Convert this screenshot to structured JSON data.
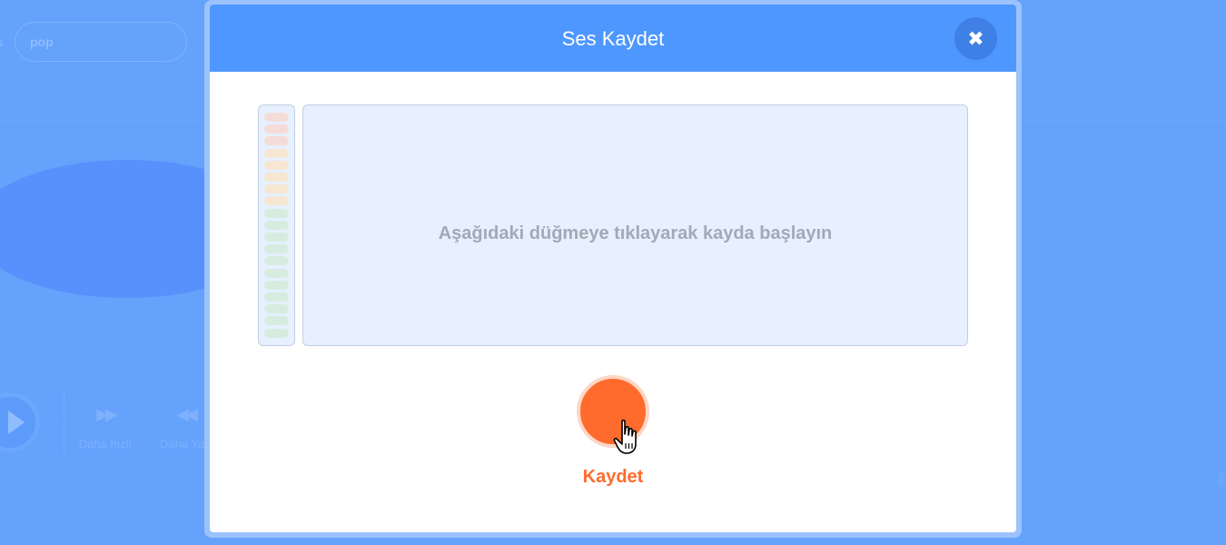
{
  "background": {
    "search_prefix": "s",
    "search_value": "pop",
    "controls": [
      {
        "icon": "fast-forward-icon",
        "glyph": "▶▶",
        "label": "Daha hızlı"
      },
      {
        "icon": "rewind-icon",
        "glyph": "◀◀",
        "label": "Daha Yav"
      }
    ]
  },
  "modal": {
    "title": "Ses Kaydet",
    "close_glyph": "✖",
    "instruction": "Aşağıdaki düğmeye tıklayarak kayda başlayın",
    "record_label": "Kaydet",
    "meter_colors": {
      "red": "#f6dcd9",
      "orange": "#f6e6d2",
      "green": "#d7ecdf"
    }
  },
  "colors": {
    "header": "#4d97ff",
    "record": "#ff6b2c",
    "overlay": "#64a2fc"
  }
}
